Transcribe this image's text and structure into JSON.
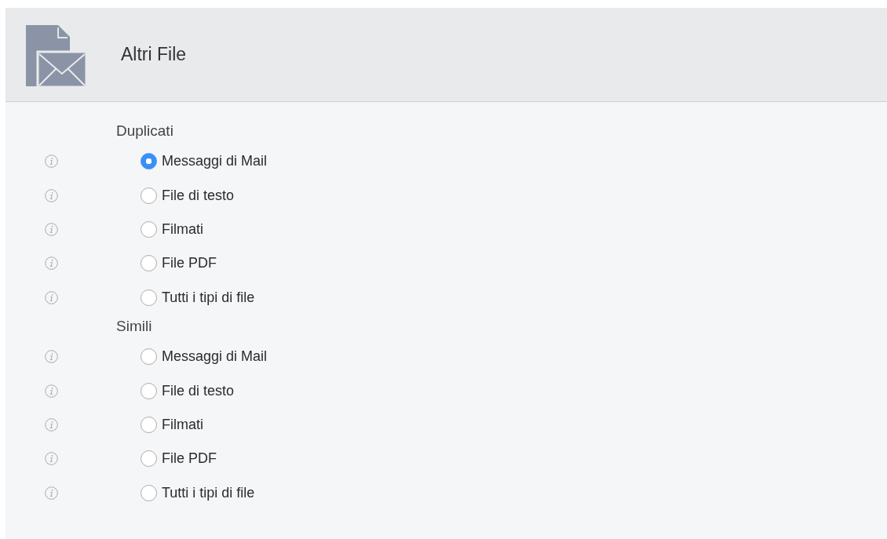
{
  "header": {
    "title": "Altri File"
  },
  "sections": [
    {
      "heading": "Duplicati",
      "options": [
        {
          "label": "Messaggi di Mail",
          "selected": true
        },
        {
          "label": "File di testo",
          "selected": false
        },
        {
          "label": "Filmati",
          "selected": false
        },
        {
          "label": "File PDF",
          "selected": false
        },
        {
          "label": "Tutti i tipi di file",
          "selected": false
        }
      ]
    },
    {
      "heading": "Simili",
      "options": [
        {
          "label": "Messaggi di Mail",
          "selected": false
        },
        {
          "label": "File di testo",
          "selected": false
        },
        {
          "label": "Filmati",
          "selected": false
        },
        {
          "label": "File PDF",
          "selected": false
        },
        {
          "label": "Tutti i tipi di file",
          "selected": false
        }
      ]
    }
  ]
}
